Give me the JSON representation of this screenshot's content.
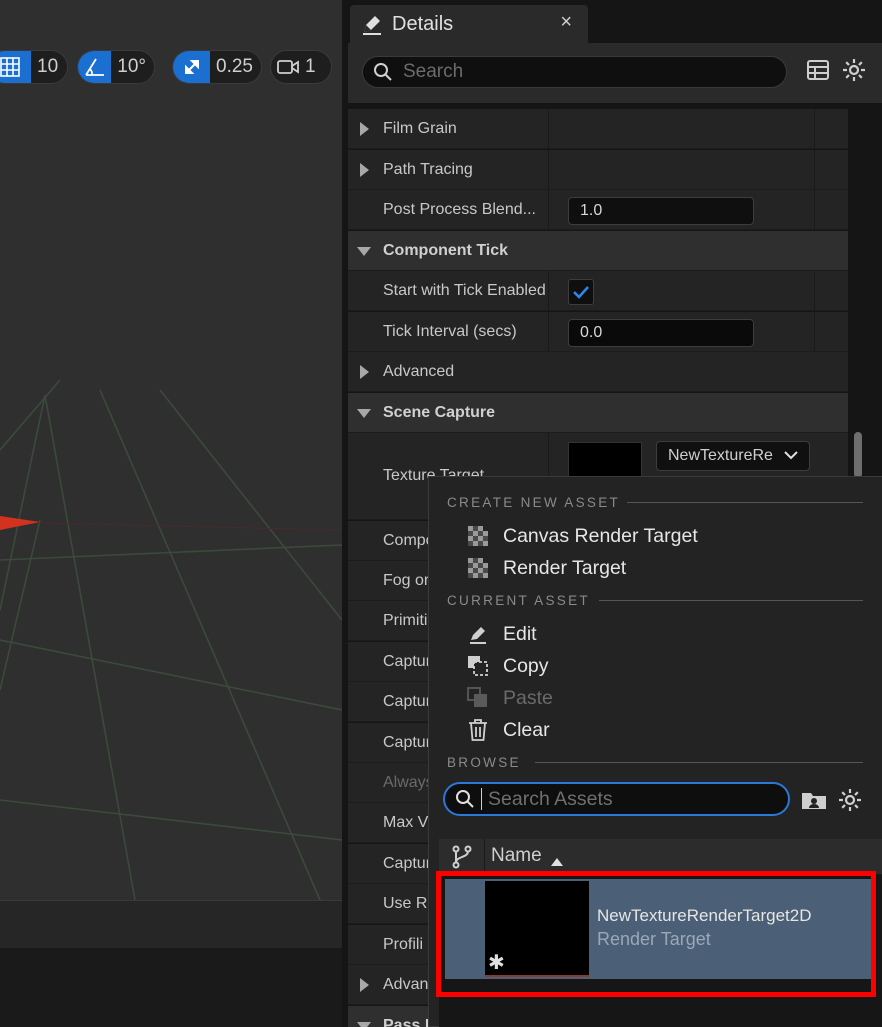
{
  "viewport": {
    "toolbar": {
      "grid_snap_value": "10",
      "rotation_snap_value": "10°",
      "scale_snap_value": "0.25",
      "camera_speed_value": "1"
    }
  },
  "details": {
    "tab_title": "Details",
    "tab_close": "×",
    "search_placeholder": "Search",
    "rows": {
      "film_grain": "Film Grain",
      "path_tracing": "Path Tracing",
      "post_process_blend": "Post Process Blend...",
      "post_process_blend_value": "1.0",
      "component_tick": "Component Tick",
      "start_with_tick": "Start with Tick Enabled",
      "tick_interval": "Tick Interval (secs)",
      "tick_interval_value": "0.0",
      "advanced": "Advanced",
      "scene_capture": "Scene Capture",
      "texture_target": "Texture Target",
      "texture_target_value": "NewTextureRe",
      "r_compo": "Compo",
      "r_fog": "Fog or",
      "r_primiti": "Primiti",
      "r_captur1": "Captur",
      "r_captur2": "Captur",
      "r_captur3": "Captur",
      "r_always": "Always",
      "r_maxv": "Max V",
      "r_captur4": "Captur",
      "r_usera": "Use Ra",
      "r_profili": "Profili",
      "r_advan": "Advan",
      "r_pass": "Pass I"
    },
    "start_with_tick_checked": true
  },
  "menu": {
    "create_new_asset": "CREATE NEW ASSET",
    "canvas_render_target": "Canvas Render Target",
    "render_target": "Render Target",
    "current_asset": "CURRENT ASSET",
    "edit": "Edit",
    "copy": "Copy",
    "paste": "Paste",
    "clear": "Clear",
    "browse": "BROWSE",
    "search_assets_placeholder": "Search Assets",
    "column_name": "Name",
    "asset": {
      "name": "NewTextureRenderTarget2D",
      "type": "Render Target"
    }
  },
  "colors": {
    "accent_blue": "#1a6fd0",
    "highlight_red": "#ff0000",
    "selected_row": "#4b5f76"
  },
  "icons": [
    "grid-icon",
    "angle-icon",
    "scale-icon",
    "camera-icon",
    "pencil-icon",
    "search-icon",
    "table-icon",
    "gear-icon",
    "checker-icon",
    "copy-icon",
    "paste-icon",
    "trash-icon",
    "folder-icon",
    "branch-icon",
    "sort-up-icon"
  ]
}
